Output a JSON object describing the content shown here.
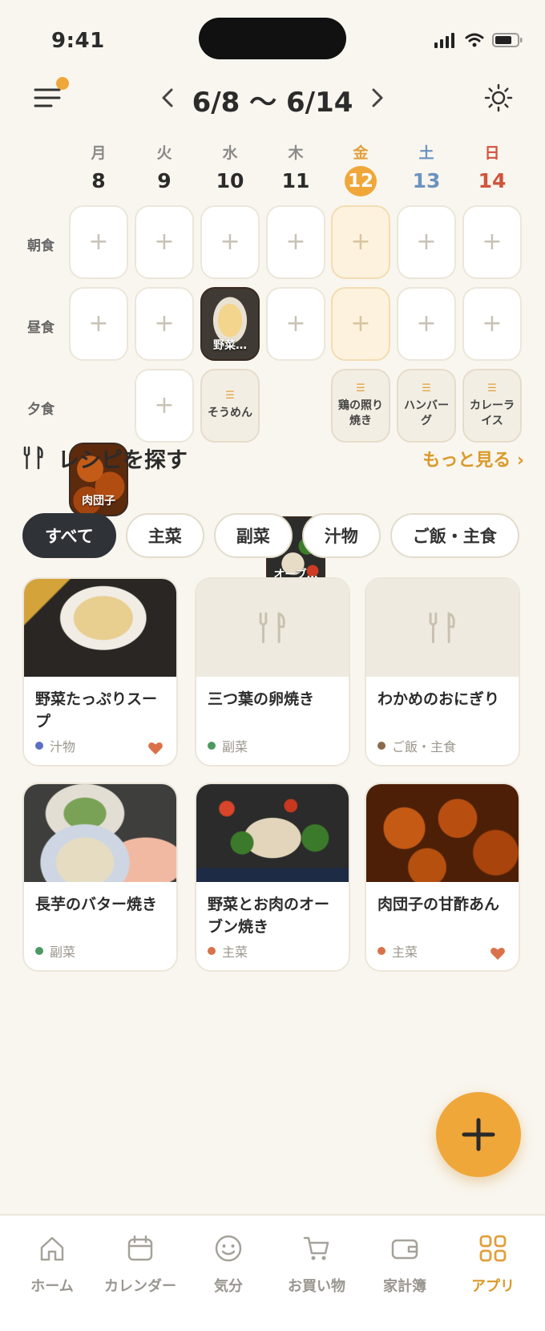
{
  "status": {
    "time": "9:41"
  },
  "header": {
    "week_range": "6/8 〜 6/14",
    "prev_icon": "chevron-left-icon",
    "next_icon": "chevron-right-icon",
    "menu_icon": "menu-icon",
    "theme_icon": "sun-icon"
  },
  "days": [
    {
      "weekday": "月",
      "date": "8"
    },
    {
      "weekday": "火",
      "date": "9"
    },
    {
      "weekday": "水",
      "date": "10"
    },
    {
      "weekday": "木",
      "date": "11"
    },
    {
      "weekday": "金",
      "date": "12"
    },
    {
      "weekday": "土",
      "date": "13"
    },
    {
      "weekday": "日",
      "date": "14"
    }
  ],
  "meals": {
    "breakfast": {
      "label": "朝食"
    },
    "lunch": {
      "label": "昼食",
      "wed": "野菜…"
    },
    "dinner": {
      "label": "夕食",
      "mon": "肉団子",
      "wed": "そうめん",
      "thu": "オーブ…",
      "fri": "鶏の照り焼き",
      "sat": "ハンバーグ",
      "sun": "カレーライス"
    },
    "add_symbol": "+"
  },
  "recipes_section": {
    "title": "レシピを探す",
    "more_label": "もっと見る",
    "more_arrow": "›",
    "chips": [
      "すべて",
      "主菜",
      "副菜",
      "汁物",
      "ご飯・主食"
    ],
    "cards": [
      {
        "title": "野菜たっぷりスープ",
        "category": "汁物",
        "dot_color": "#5b6fc7",
        "favorite": true
      },
      {
        "title": "三つ葉の卵焼き",
        "category": "副菜",
        "dot_color": "#4c9a63",
        "favorite": false
      },
      {
        "title": "わかめのおにぎり",
        "category": "ご飯・主食",
        "dot_color": "#8a6a4a",
        "favorite": false
      },
      {
        "title": "長芋のバター焼き",
        "category": "副菜",
        "dot_color": "#4c9a63",
        "favorite": false
      },
      {
        "title": "野菜とお肉のオーブン焼き",
        "category": "主菜",
        "dot_color": "#d9724a",
        "favorite": false
      },
      {
        "title": "肉団子の甘酢あん",
        "category": "主菜",
        "dot_color": "#d9724a",
        "favorite": true
      }
    ]
  },
  "tabs": [
    {
      "label": "ホーム",
      "icon": "home-icon"
    },
    {
      "label": "カレンダー",
      "icon": "calendar-icon"
    },
    {
      "label": "気分",
      "icon": "smile-icon"
    },
    {
      "label": "お買い物",
      "icon": "cart-icon"
    },
    {
      "label": "家計簿",
      "icon": "wallet-icon"
    },
    {
      "label": "アプリ",
      "icon": "apps-grid-icon",
      "active": true
    }
  ],
  "colors": {
    "accent": "#f0a73a",
    "accent_text": "#d99a2b",
    "saturday": "#6b93c0",
    "sunday": "#d0543c",
    "background": "#f9f6ef"
  }
}
